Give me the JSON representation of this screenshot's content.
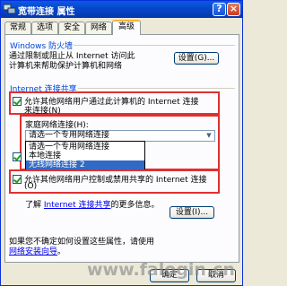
{
  "window": {
    "title": "宽带连接 属性",
    "help_glyph": "?",
    "close_glyph": "×"
  },
  "tabs": [
    "常规",
    "选项",
    "安全",
    "网络",
    "高级"
  ],
  "firewall": {
    "group_title": "Windows 防火墙",
    "description_line1": "通过限制或阻止从 Internet 访问此",
    "description_line2": "计算机来帮助保护计算机和网络",
    "settings_button": "设置(G)..."
  },
  "ics": {
    "group_title": "Internet 连接共享",
    "allow_other_users": {
      "line1": "允许其他网络用户通过此计算机的 Internet 连接",
      "line2": "来连接(N)",
      "checked": true
    },
    "home_network_label": "家庭网络连接(H):",
    "home_network_select": {
      "value": "请选一个专用网络连接",
      "arrow_glyph": "▼"
    },
    "dropdown_options": [
      "请选一个专用网络连接",
      "本地连接",
      "无线网络连接 2"
    ],
    "selected_option_index": 2,
    "allow_control": {
      "line1": "允许其他网络用户控制或禁用共享的 Internet 连接",
      "line2": "(O)",
      "checked": true
    },
    "learn_more": {
      "prefix": "了解",
      "link": "Internet 连接共享",
      "suffix": "的更多信息。"
    },
    "settings_button": "设置(I)..."
  },
  "footer": {
    "line1": "如果您不确定如何设置这些属性，请使用",
    "link": "网络安装向导",
    "line2_suffix": "。"
  },
  "buttons": {
    "ok": "确定",
    "cancel": "取消"
  },
  "watermark": "www.falogin.cn",
  "colors": {
    "highlight_box": "#e03030",
    "link": "#0000ee",
    "selection": "#316ac5",
    "titlebar": "#0846c8"
  }
}
